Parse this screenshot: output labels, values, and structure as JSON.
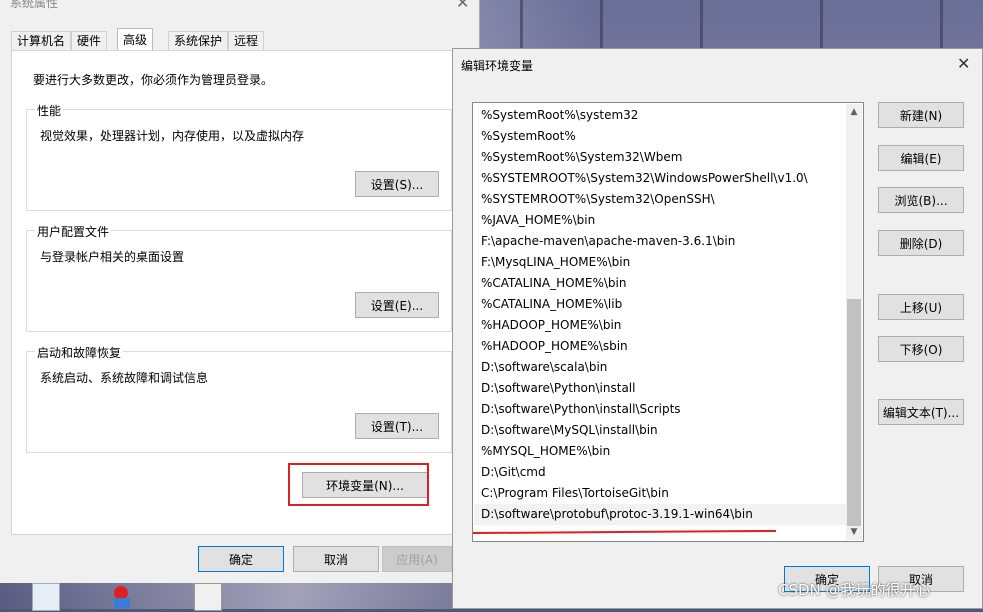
{
  "system_properties": {
    "title": "系统属性",
    "tabs": [
      {
        "label": "计算机名"
      },
      {
        "label": "硬件"
      },
      {
        "label": "高级"
      },
      {
        "label": "系统保护"
      },
      {
        "label": "远程"
      }
    ],
    "active_tab": "高级",
    "admin_note": "要进行大多数更改，你必须作为管理员登录。",
    "groups": {
      "performance": {
        "title": "性能",
        "desc": "视觉效果，处理器计划，内存使用，以及虚拟内存",
        "button": "设置(S)..."
      },
      "user_profiles": {
        "title": "用户配置文件",
        "desc": "与登录帐户相关的桌面设置",
        "button": "设置(E)..."
      },
      "startup_recovery": {
        "title": "启动和故障恢复",
        "desc": "系统启动、系统故障和调试信息",
        "button": "设置(T)..."
      }
    },
    "env_vars_button": "环境变量(N)...",
    "ok_button": "确定",
    "cancel_button": "取消",
    "apply_button": "应用(A)"
  },
  "edit_env": {
    "title": "编辑环境变量",
    "entries": [
      "%SystemRoot%\\system32",
      "%SystemRoot%",
      "%SystemRoot%\\System32\\Wbem",
      "%SYSTEMROOT%\\System32\\WindowsPowerShell\\v1.0\\",
      "%SYSTEMROOT%\\System32\\OpenSSH\\",
      "%JAVA_HOME%\\bin",
      "F:\\apache-maven\\apache-maven-3.6.1\\bin",
      "F:\\MysqLINA_HOME%\\bin",
      "%CATALINA_HOME%\\bin",
      "%CATALINA_HOME%\\lib",
      "%HADOOP_HOME%\\bin",
      "%HADOOP_HOME%\\sbin",
      "D:\\software\\scala\\bin",
      "D:\\software\\Python\\install",
      "D:\\software\\Python\\install\\Scripts",
      "D:\\software\\MySQL\\install\\bin",
      "%MYSQL_HOME%\\bin",
      "D:\\Git\\cmd",
      "C:\\Program Files\\TortoiseGit\\bin",
      "D:\\software\\protobuf\\protoc-3.19.1-win64\\bin"
    ],
    "selected_index": 19,
    "buttons": {
      "new": "新建(N)",
      "edit": "编辑(E)",
      "browse": "浏览(B)...",
      "delete": "删除(D)",
      "move_up": "上移(U)",
      "move_down": "下移(O)",
      "edit_text": "编辑文本(T)...",
      "ok": "确定",
      "cancel": "取消"
    }
  },
  "watermark": "CSDN @我玩的很开心",
  "colors": {
    "highlight_red": "#e02020",
    "focus_blue": "#0078d7"
  }
}
